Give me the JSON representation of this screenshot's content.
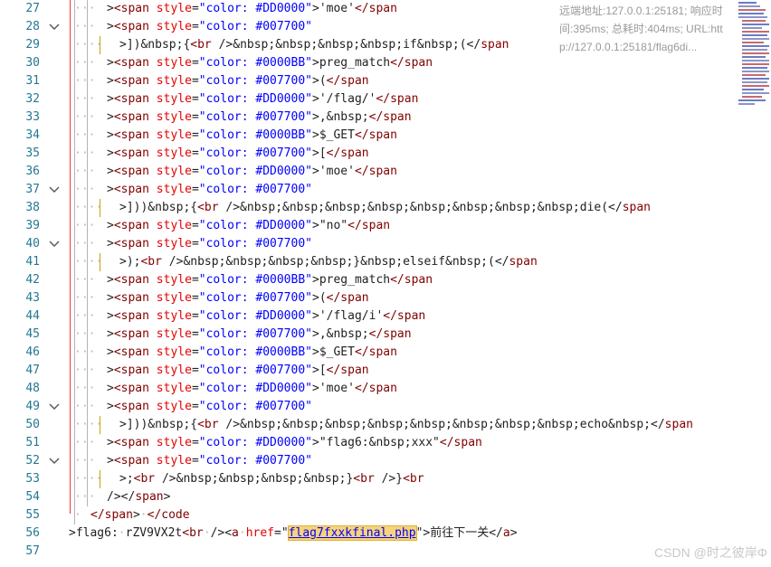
{
  "editor": {
    "lines": [
      {
        "n": "27",
        "fold": false,
        "indent": 2,
        "bar": "grey",
        "tokens": [
          [
            "t",
            ">"
          ],
          [
            "tag",
            "<span "
          ],
          [
            "attr",
            "style"
          ],
          [
            "t",
            "="
          ],
          [
            "str",
            "\"color: #DD0000\""
          ],
          [
            "t",
            ">'moe'"
          ],
          [
            "tag",
            "</span"
          ]
        ]
      },
      {
        "n": "28",
        "fold": true,
        "indent": 2,
        "bar": "grey",
        "tokens": [
          [
            "t",
            ">"
          ],
          [
            "tag",
            "<span "
          ],
          [
            "attr",
            "style"
          ],
          [
            "t",
            "="
          ],
          [
            "str",
            "\"color: #007700\""
          ]
        ]
      },
      {
        "n": "29",
        "fold": false,
        "indent": 3,
        "bar": "gold",
        "tokens": [
          [
            "t",
            ">])&nbsp;{"
          ],
          [
            "tag",
            "<br "
          ],
          [
            "t",
            "/>&nbsp;&nbsp;&nbsp;&nbsp;if&nbsp;(</"
          ],
          [
            "tag",
            "span"
          ]
        ]
      },
      {
        "n": "30",
        "fold": false,
        "indent": 2,
        "bar": "grey",
        "tokens": [
          [
            "t",
            ">"
          ],
          [
            "tag",
            "<span "
          ],
          [
            "attr",
            "style"
          ],
          [
            "t",
            "="
          ],
          [
            "str",
            "\"color: #0000BB\""
          ],
          [
            "t",
            ">preg_match"
          ],
          [
            "tag",
            "</span"
          ]
        ]
      },
      {
        "n": "31",
        "fold": false,
        "indent": 2,
        "bar": "grey",
        "tokens": [
          [
            "t",
            ">"
          ],
          [
            "tag",
            "<span "
          ],
          [
            "attr",
            "style"
          ],
          [
            "t",
            "="
          ],
          [
            "str",
            "\"color: #007700\""
          ],
          [
            "t",
            ">("
          ],
          [
            "tag",
            "</span"
          ]
        ]
      },
      {
        "n": "32",
        "fold": false,
        "indent": 2,
        "bar": "grey",
        "tokens": [
          [
            "t",
            ">"
          ],
          [
            "tag",
            "<span "
          ],
          [
            "attr",
            "style"
          ],
          [
            "t",
            "="
          ],
          [
            "str",
            "\"color: #DD0000\""
          ],
          [
            "t",
            ">'/flag/'"
          ],
          [
            "tag",
            "</span"
          ]
        ]
      },
      {
        "n": "33",
        "fold": false,
        "indent": 2,
        "bar": "grey",
        "tokens": [
          [
            "t",
            ">"
          ],
          [
            "tag",
            "<span "
          ],
          [
            "attr",
            "style"
          ],
          [
            "t",
            "="
          ],
          [
            "str",
            "\"color: #007700\""
          ],
          [
            "t",
            ">,&nbsp;"
          ],
          [
            "tag",
            "</span"
          ]
        ]
      },
      {
        "n": "34",
        "fold": false,
        "indent": 2,
        "bar": "grey",
        "tokens": [
          [
            "t",
            ">"
          ],
          [
            "tag",
            "<span "
          ],
          [
            "attr",
            "style"
          ],
          [
            "t",
            "="
          ],
          [
            "str",
            "\"color: #0000BB\""
          ],
          [
            "t",
            ">$_GET"
          ],
          [
            "tag",
            "</span"
          ]
        ]
      },
      {
        "n": "35",
        "fold": false,
        "indent": 2,
        "bar": "grey",
        "tokens": [
          [
            "t",
            ">"
          ],
          [
            "tag",
            "<span "
          ],
          [
            "attr",
            "style"
          ],
          [
            "t",
            "="
          ],
          [
            "str",
            "\"color: #007700\""
          ],
          [
            "t",
            ">["
          ],
          [
            "tag",
            "</span"
          ]
        ]
      },
      {
        "n": "36",
        "fold": false,
        "indent": 2,
        "bar": "grey",
        "tokens": [
          [
            "t",
            ">"
          ],
          [
            "tag",
            "<span "
          ],
          [
            "attr",
            "style"
          ],
          [
            "t",
            "="
          ],
          [
            "str",
            "\"color: #DD0000\""
          ],
          [
            "t",
            ">'moe'"
          ],
          [
            "tag",
            "</span"
          ]
        ]
      },
      {
        "n": "37",
        "fold": true,
        "indent": 2,
        "bar": "grey",
        "tokens": [
          [
            "t",
            ">"
          ],
          [
            "tag",
            "<span "
          ],
          [
            "attr",
            "style"
          ],
          [
            "t",
            "="
          ],
          [
            "str",
            "\"color: #007700\""
          ]
        ]
      },
      {
        "n": "38",
        "fold": false,
        "indent": 3,
        "bar": "gold",
        "tokens": [
          [
            "t",
            ">]))&nbsp;{"
          ],
          [
            "tag",
            "<br "
          ],
          [
            "t",
            "/>&nbsp;&nbsp;&nbsp;&nbsp;&nbsp;&nbsp;&nbsp;&nbsp;die(</"
          ],
          [
            "tag",
            "span"
          ]
        ]
      },
      {
        "n": "39",
        "fold": false,
        "indent": 2,
        "bar": "grey",
        "tokens": [
          [
            "t",
            ">"
          ],
          [
            "tag",
            "<span "
          ],
          [
            "attr",
            "style"
          ],
          [
            "t",
            "="
          ],
          [
            "str",
            "\"color: #DD0000\""
          ],
          [
            "t",
            ">\"no\""
          ],
          [
            "tag",
            "</span"
          ]
        ]
      },
      {
        "n": "40",
        "fold": true,
        "indent": 2,
        "bar": "grey",
        "tokens": [
          [
            "t",
            ">"
          ],
          [
            "tag",
            "<span "
          ],
          [
            "attr",
            "style"
          ],
          [
            "t",
            "="
          ],
          [
            "str",
            "\"color: #007700\""
          ]
        ]
      },
      {
        "n": "41",
        "fold": false,
        "indent": 3,
        "bar": "gold",
        "tokens": [
          [
            "t",
            ">);"
          ],
          [
            "tag",
            "<br "
          ],
          [
            "t",
            "/>&nbsp;&nbsp;&nbsp;&nbsp;}&nbsp;elseif&nbsp;(</"
          ],
          [
            "tag",
            "span"
          ]
        ]
      },
      {
        "n": "42",
        "fold": false,
        "indent": 2,
        "bar": "grey",
        "tokens": [
          [
            "t",
            ">"
          ],
          [
            "tag",
            "<span "
          ],
          [
            "attr",
            "style"
          ],
          [
            "t",
            "="
          ],
          [
            "str",
            "\"color: #0000BB\""
          ],
          [
            "t",
            ">preg_match"
          ],
          [
            "tag",
            "</span"
          ]
        ]
      },
      {
        "n": "43",
        "fold": false,
        "indent": 2,
        "bar": "grey",
        "tokens": [
          [
            "t",
            ">"
          ],
          [
            "tag",
            "<span "
          ],
          [
            "attr",
            "style"
          ],
          [
            "t",
            "="
          ],
          [
            "str",
            "\"color: #007700\""
          ],
          [
            "t",
            ">("
          ],
          [
            "tag",
            "</span"
          ]
        ]
      },
      {
        "n": "44",
        "fold": false,
        "indent": 2,
        "bar": "grey",
        "tokens": [
          [
            "t",
            ">"
          ],
          [
            "tag",
            "<span "
          ],
          [
            "attr",
            "style"
          ],
          [
            "t",
            "="
          ],
          [
            "str",
            "\"color: #DD0000\""
          ],
          [
            "t",
            ">'/flag/i'"
          ],
          [
            "tag",
            "</span"
          ]
        ]
      },
      {
        "n": "45",
        "fold": false,
        "indent": 2,
        "bar": "grey",
        "tokens": [
          [
            "t",
            ">"
          ],
          [
            "tag",
            "<span "
          ],
          [
            "attr",
            "style"
          ],
          [
            "t",
            "="
          ],
          [
            "str",
            "\"color: #007700\""
          ],
          [
            "t",
            ">,&nbsp;"
          ],
          [
            "tag",
            "</span"
          ]
        ]
      },
      {
        "n": "46",
        "fold": false,
        "indent": 2,
        "bar": "grey",
        "tokens": [
          [
            "t",
            ">"
          ],
          [
            "tag",
            "<span "
          ],
          [
            "attr",
            "style"
          ],
          [
            "t",
            "="
          ],
          [
            "str",
            "\"color: #0000BB\""
          ],
          [
            "t",
            ">$_GET"
          ],
          [
            "tag",
            "</span"
          ]
        ]
      },
      {
        "n": "47",
        "fold": false,
        "indent": 2,
        "bar": "grey",
        "tokens": [
          [
            "t",
            ">"
          ],
          [
            "tag",
            "<span "
          ],
          [
            "attr",
            "style"
          ],
          [
            "t",
            "="
          ],
          [
            "str",
            "\"color: #007700\""
          ],
          [
            "t",
            ">["
          ],
          [
            "tag",
            "</span"
          ]
        ]
      },
      {
        "n": "48",
        "fold": false,
        "indent": 2,
        "bar": "grey",
        "tokens": [
          [
            "t",
            ">"
          ],
          [
            "tag",
            "<span "
          ],
          [
            "attr",
            "style"
          ],
          [
            "t",
            "="
          ],
          [
            "str",
            "\"color: #DD0000\""
          ],
          [
            "t",
            ">'moe'"
          ],
          [
            "tag",
            "</span"
          ]
        ]
      },
      {
        "n": "49",
        "fold": true,
        "indent": 2,
        "bar": "grey",
        "tokens": [
          [
            "t",
            ">"
          ],
          [
            "tag",
            "<span "
          ],
          [
            "attr",
            "style"
          ],
          [
            "t",
            "="
          ],
          [
            "str",
            "\"color: #007700\""
          ]
        ]
      },
      {
        "n": "50",
        "fold": false,
        "indent": 3,
        "bar": "gold",
        "tokens": [
          [
            "t",
            ">]))&nbsp;{"
          ],
          [
            "tag",
            "<br "
          ],
          [
            "t",
            "/>&nbsp;&nbsp;&nbsp;&nbsp;&nbsp;&nbsp;&nbsp;&nbsp;echo&nbsp;</"
          ],
          [
            "tag",
            "span"
          ]
        ]
      },
      {
        "n": "51",
        "fold": false,
        "indent": 2,
        "bar": "grey",
        "tokens": [
          [
            "t",
            ">"
          ],
          [
            "tag",
            "<span "
          ],
          [
            "attr",
            "style"
          ],
          [
            "t",
            "="
          ],
          [
            "str",
            "\"color: #DD0000\""
          ],
          [
            "t",
            ">\"flag6:&nbsp;xxx\""
          ],
          [
            "tag",
            "</span"
          ]
        ]
      },
      {
        "n": "52",
        "fold": true,
        "indent": 2,
        "bar": "grey",
        "tokens": [
          [
            "t",
            ">"
          ],
          [
            "tag",
            "<span "
          ],
          [
            "attr",
            "style"
          ],
          [
            "t",
            "="
          ],
          [
            "str",
            "\"color: #007700\""
          ]
        ]
      },
      {
        "n": "53",
        "fold": false,
        "indent": 3,
        "bar": "gold",
        "tokens": [
          [
            "t",
            ">;"
          ],
          [
            "tag",
            "<br "
          ],
          [
            "t",
            "/>&nbsp;&nbsp;&nbsp;&nbsp;}"
          ],
          [
            "tag",
            "<br "
          ],
          [
            "t",
            "/>}"
          ],
          [
            "tag",
            "<br"
          ]
        ]
      },
      {
        "n": "54",
        "fold": false,
        "indent": 2,
        "bar": "grey",
        "tokens": [
          [
            "t",
            "/></"
          ],
          [
            "tag",
            "span"
          ],
          [
            "t",
            ">"
          ]
        ]
      },
      {
        "n": "55",
        "fold": false,
        "indent": 1,
        "bar": "grey",
        "tokens": [
          [
            "tag",
            "</span"
          ],
          [
            "t",
            ">"
          ],
          [
            "ws",
            "·"
          ],
          [
            "tag",
            "</code"
          ]
        ]
      },
      {
        "n": "56",
        "fold": false,
        "indent": 0,
        "bar": "none",
        "tokens": [
          [
            "t",
            ">flag6:"
          ],
          [
            "ws",
            "·"
          ],
          [
            "t",
            "rZV9VX2t"
          ],
          [
            "tag",
            "<br"
          ],
          [
            "ws",
            "·"
          ],
          [
            "t",
            "/><"
          ],
          [
            "tag",
            "a"
          ],
          [
            "ws",
            "·"
          ],
          [
            "attr",
            "href"
          ],
          [
            "t",
            "=\""
          ],
          [
            "hl",
            "flag7fxxkfinal.php"
          ],
          [
            "t",
            "\">前往下一关</"
          ],
          [
            "tag",
            "a"
          ],
          [
            "t",
            ">"
          ]
        ]
      },
      {
        "n": "57",
        "fold": false,
        "indent": 0,
        "bar": "none",
        "tokens": []
      }
    ]
  },
  "tooltip": {
    "line1": "远端地址:127.0.0.1:25181; 响应时",
    "line2": "间:395ms; 总耗时:404ms; URL:htt",
    "line3": "p://127.0.0.1:25181/flag6di..."
  },
  "watermark": "CSDN @时之彼岸Φ",
  "colors": {
    "line_number": "#237893",
    "tag": "#800000",
    "attribute": "#e50000",
    "string": "#0000ff",
    "indent_guide_error": "#e53935",
    "selection_highlight": "#f7d37b"
  },
  "icons": {
    "fold": "chevron-down-icon"
  }
}
